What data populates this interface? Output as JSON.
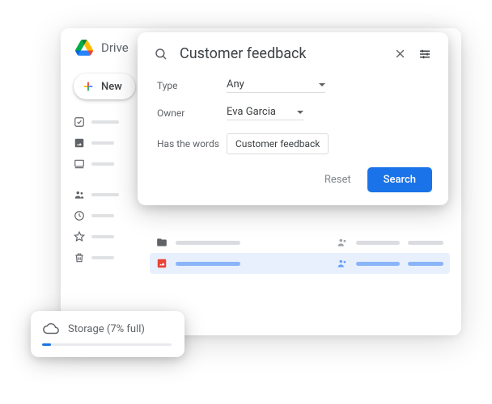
{
  "app": {
    "title": "Drive"
  },
  "sidebar": {
    "new_label": "New"
  },
  "search": {
    "query": "Customer feedback",
    "filters": {
      "type_label": "Type",
      "type_value": "Any",
      "owner_label": "Owner",
      "owner_value": "Eva Garcia",
      "words_label": "Has the words",
      "words_value": "Customer feedback"
    },
    "reset_label": "Reset",
    "search_label": "Search"
  },
  "storage": {
    "label": "Storage (7% full)",
    "percent": 7
  }
}
